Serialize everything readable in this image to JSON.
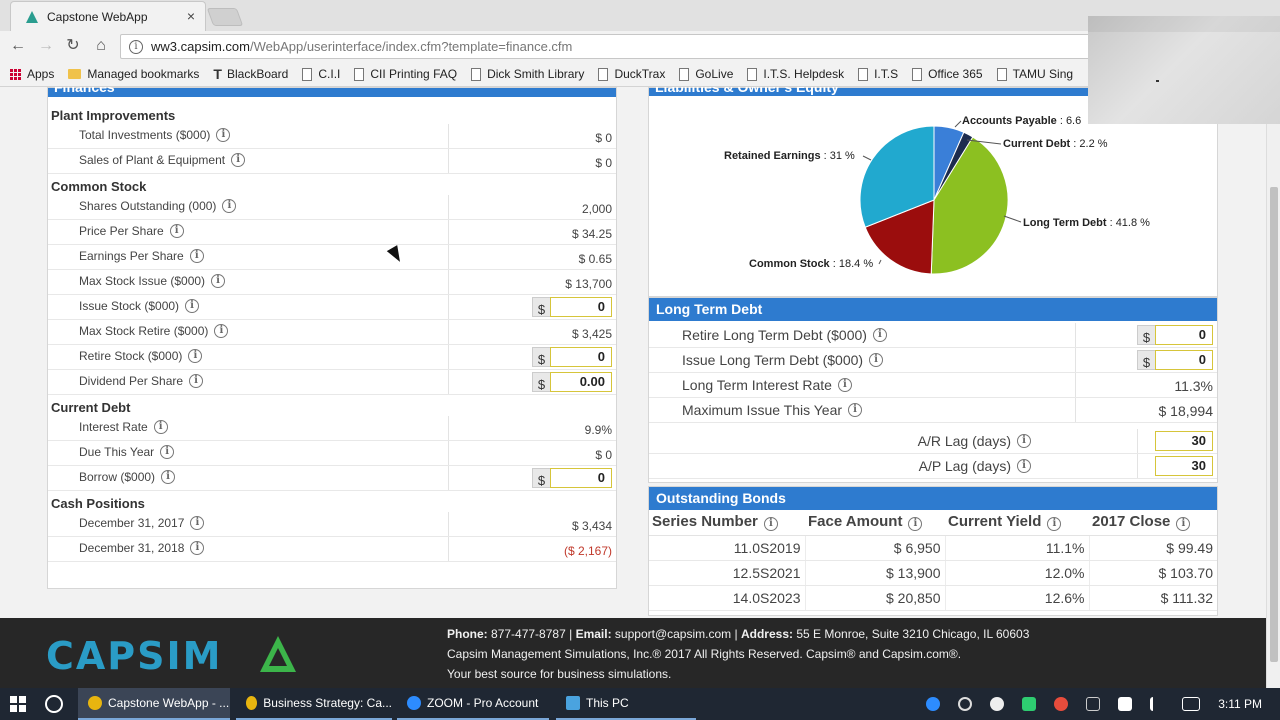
{
  "browser": {
    "tab_title": "Capstone WebApp",
    "tab_close": "×",
    "url_host": "ww3.capsim.com",
    "url_path": "/WebApp/userinterface/index.cfm?template=finance.cfm",
    "bookmarks": [
      "Apps",
      "Managed bookmarks",
      "BlackBoard",
      "C.I.I",
      "CII Printing FAQ",
      "Dick Smith Library",
      "DuckTrax",
      "GoLive",
      "I.T.S. Helpdesk",
      "I.T.S",
      "Office 365",
      "TAMU Sing"
    ]
  },
  "finance": {
    "header": "Finances",
    "sections": {
      "plant": "Plant Improvements",
      "stock": "Common Stock",
      "debt": "Current Debt",
      "cash": "Cash Positions"
    },
    "rows": {
      "total_investments": {
        "label": "Total Investments ($000)",
        "value": "$ 0"
      },
      "sales_plant": {
        "label": "Sales of Plant & Equipment",
        "value": "$ 0"
      },
      "shares_outstanding": {
        "label": "Shares Outstanding (000)",
        "value": "2,000"
      },
      "price_per_share": {
        "label": "Price Per Share",
        "value": "$ 34.25"
      },
      "eps": {
        "label": "Earnings Per Share",
        "value": "$ 0.65"
      },
      "max_stock_issue": {
        "label": "Max Stock Issue ($000)",
        "value": "$ 13,700"
      },
      "issue_stock": {
        "label": "Issue Stock ($000)",
        "currency": "$",
        "input": "0"
      },
      "max_stock_retire": {
        "label": "Max Stock Retire ($000)",
        "value": "$ 3,425"
      },
      "retire_stock": {
        "label": "Retire Stock ($000)",
        "currency": "$",
        "input": "0"
      },
      "dividend": {
        "label": "Dividend Per Share",
        "currency": "$",
        "input": "0.00"
      },
      "interest_rate": {
        "label": "Interest Rate",
        "value": "9.9%"
      },
      "due_this_year": {
        "label": "Due This Year",
        "value": "$ 0"
      },
      "borrow": {
        "label": "Borrow ($000)",
        "currency": "$",
        "input": "0"
      },
      "dec2017": {
        "label": "December 31, 2017",
        "value": "$ 3,434"
      },
      "dec2018": {
        "label": "December 31, 2018",
        "value": "($ 2,167)"
      }
    }
  },
  "equity": {
    "header": "Liabilities & Owner's Equity",
    "chart_data": {
      "type": "pie",
      "slices": [
        {
          "label": "Accounts Payable",
          "value": 6.6,
          "color": "#3a7fd8"
        },
        {
          "label": "Current Debt",
          "value": 2.2,
          "color": "#1d2c4f"
        },
        {
          "label": "Long Term Debt",
          "value": 41.8,
          "color": "#8cc021"
        },
        {
          "label": "Common Stock",
          "value": 18.4,
          "color": "#9b0d0d"
        },
        {
          "label": "Retained Earnings",
          "value": 31.0,
          "color": "#21a9cf"
        }
      ],
      "labels_text": {
        "ap": "Accounts Payable",
        "ap_val": ": 6.6",
        "cd": "Current Debt",
        "cd_val": ": 2.2 %",
        "ltd": "Long Term Debt",
        "ltd_val": ": 41.8 %",
        "cs": "Common Stock",
        "cs_val": ": 18.4 %",
        "re": "Retained Earnings",
        "re_val": ": 31 %"
      }
    }
  },
  "ltd": {
    "header": "Long Term Debt",
    "retire": {
      "label": "Retire Long Term Debt ($000)",
      "currency": "$",
      "input": "0"
    },
    "issue": {
      "label": "Issue Long Term Debt ($000)",
      "currency": "$",
      "input": "0"
    },
    "rate": {
      "label": "Long Term Interest Rate",
      "value": "11.3%"
    },
    "max_issue": {
      "label": "Maximum Issue This Year",
      "value": "$ 18,994"
    },
    "ar_lag": {
      "label": "A/R Lag (days)",
      "input": "30"
    },
    "ap_lag": {
      "label": "A/P Lag (days)",
      "input": "30"
    }
  },
  "bonds": {
    "header": "Outstanding Bonds",
    "columns": [
      "Series Number",
      "Face Amount",
      "Current Yield",
      "2017 Close"
    ],
    "rows": [
      [
        "11.0S2019",
        "$ 6,950",
        "11.1%",
        "$ 99.49"
      ],
      [
        "12.5S2021",
        "$ 13,900",
        "12.0%",
        "$ 103.70"
      ],
      [
        "14.0S2023",
        "$ 20,850",
        "12.6%",
        "$ 111.32"
      ]
    ]
  },
  "footer": {
    "logo": "CAPSIM",
    "phone_label": "Phone:",
    "phone": "877-477-8787",
    "email_label": "Email:",
    "email": "support@capsim.com",
    "address_label": "Address:",
    "address": "55 E Monroe, Suite 3210 Chicago, IL 60603",
    "sep": "|",
    "copyright": "Capsim Management Simulations, Inc.® 2017   All Rights Reserved. Capsim® and Capsim.com®.",
    "tagline": "Your best source for business simulations."
  },
  "taskbar": {
    "items": [
      "Capstone WebApp - ...",
      "Business Strategy: Ca...",
      "ZOOM - Pro Account",
      "This PC"
    ],
    "clock": "3:11 PM"
  },
  "info_glyph": "i",
  "colors": {
    "accent": "#2e7bcf",
    "negative": "#c0392b",
    "input_border": "#d6c53a"
  }
}
